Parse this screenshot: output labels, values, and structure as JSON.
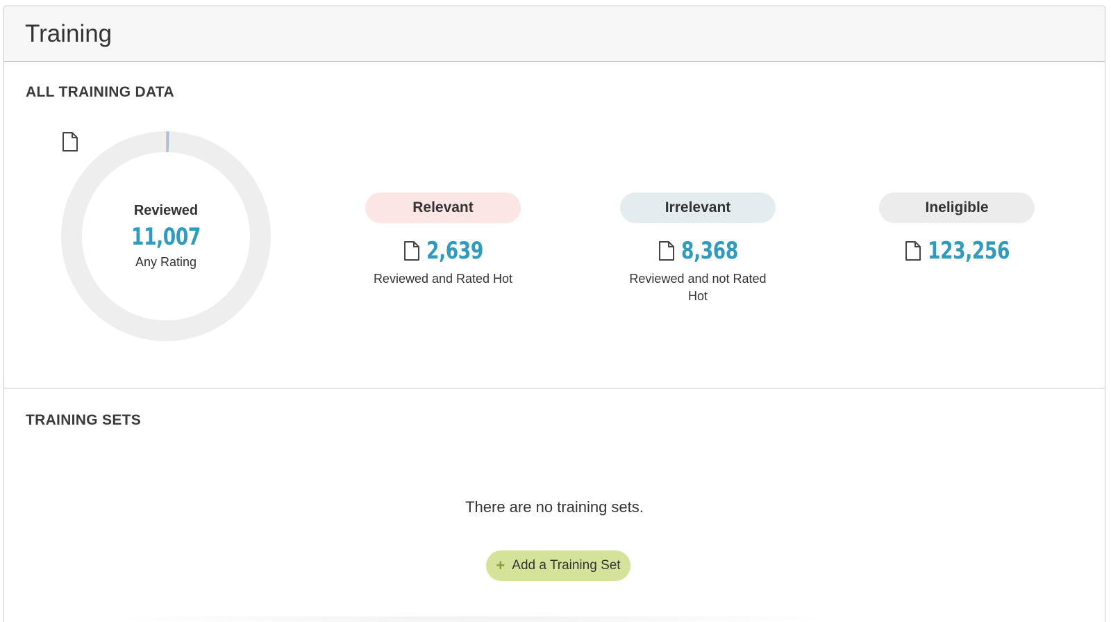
{
  "header": {
    "title": "Training"
  },
  "all_training": {
    "section_title": "ALL TRAINING DATA",
    "donut": {
      "label": "Reviewed",
      "count": "11,007",
      "sublabel": "Any Rating",
      "track_color": "#eeeeee",
      "relevant_fraction": 0.0198,
      "irrelevant_fraction": 0.0627,
      "relevant_color": "#f4b8bd",
      "irrelevant_color": "#8ec7df"
    },
    "stats": [
      {
        "label": "Relevant",
        "count": "2,639",
        "sublabel": "Reviewed and Rated Hot"
      },
      {
        "label": "Irrelevant",
        "count": "8,368",
        "sublabel": "Reviewed and not Rated Hot"
      },
      {
        "label": "Ineligible",
        "count": "123,256",
        "sublabel": ""
      }
    ]
  },
  "training_sets": {
    "section_title": "TRAINING SETS",
    "empty_message": "There are no training sets.",
    "add_button_label": "Add a Training Set"
  },
  "colors": {
    "accent_number": "#2f9bbf",
    "add_button_bg": "#d5e39a",
    "plus_icon": "#7ea13a"
  },
  "icons": {
    "count_icon": "document-icon",
    "add_icon": "plus-icon"
  }
}
